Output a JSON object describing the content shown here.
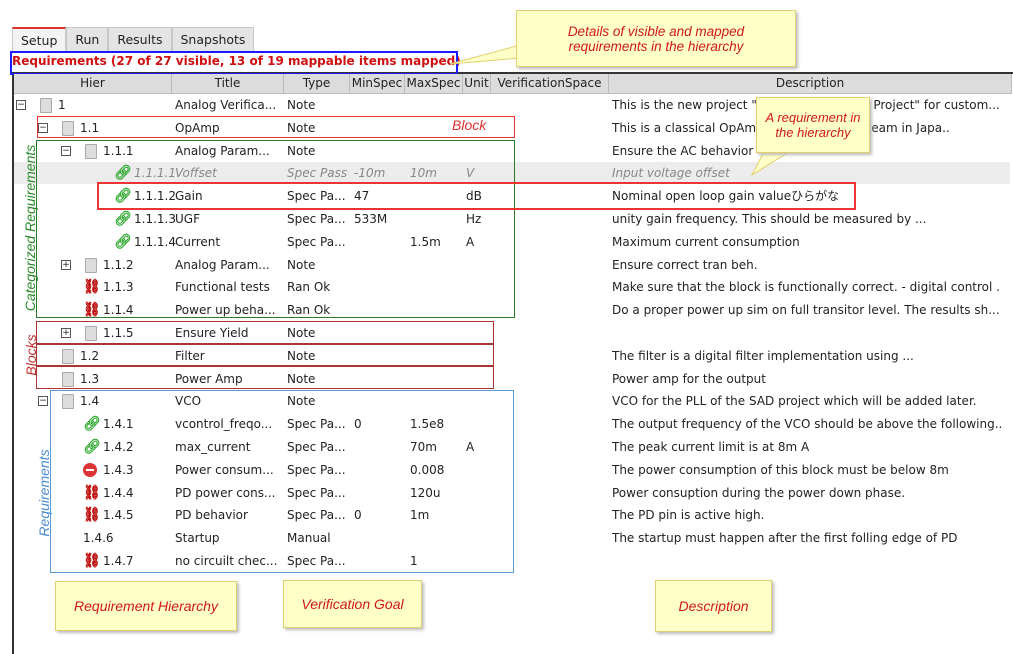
{
  "tabs": [
    "Setup",
    "Run",
    "Results",
    "Snapshots"
  ],
  "requirements_label": "Requirements (27 of 27 visible, 13 of 19 mappable items mapped)",
  "columns": [
    "Hier",
    "Title",
    "Type",
    "MinSpec",
    "MaxSpec",
    "Unit",
    "VerificationSpace",
    "Description"
  ],
  "rows": [
    {
      "hier": "1",
      "level": 0,
      "expander": "minus",
      "icon": "doc",
      "title": "Analog Verifica...",
      "type": "Note",
      "min": "",
      "max": "",
      "unit": "",
      "desc": "This is the new project \"Analog Verification Project\" for custom..."
    },
    {
      "hier": "1.1",
      "level": 1,
      "expander": "minus",
      "icon": "doc",
      "title": "OpAmp",
      "type": "Note",
      "min": "",
      "max": "",
      "unit": "",
      "desc": "This is a classical OpAmp design from our team in Japa.."
    },
    {
      "hier": "1.1.1",
      "level": 2,
      "expander": "minus",
      "icon": "doc",
      "title": "Analog Param...",
      "type": "Note",
      "min": "",
      "max": "",
      "unit": "",
      "desc": "Ensure the AC behavior"
    },
    {
      "hier": "1.1.1.1",
      "level": 3,
      "expander": "",
      "icon": "pass",
      "title": "Voffset",
      "type": "Spec Pass",
      "min": "-10m",
      "max": "10m",
      "unit": "V",
      "desc": "Input voltage offset",
      "grey": true
    },
    {
      "hier": "1.1.1.2",
      "level": 3,
      "expander": "",
      "icon": "pass",
      "title": "Gain",
      "type": "Spec Pa...",
      "min": "47",
      "max": "",
      "unit": "dB",
      "desc": "Nominal open loop gain valueひらがな"
    },
    {
      "hier": "1.1.1.3",
      "level": 3,
      "expander": "",
      "icon": "pass",
      "title": "UGF",
      "type": "Spec Pa...",
      "min": "533M",
      "max": "",
      "unit": "Hz",
      "desc": "unity gain frequency. This should be measured by ..."
    },
    {
      "hier": "1.1.1.4",
      "level": 3,
      "expander": "",
      "icon": "pass",
      "title": "Current",
      "type": "Spec Pa...",
      "min": "",
      "max": "1.5m",
      "unit": "A",
      "desc": "Maximum current consumption"
    },
    {
      "hier": "1.1.2",
      "level": 2,
      "expander": "plus",
      "icon": "doc",
      "title": "Analog Param...",
      "type": "Note",
      "min": "",
      "max": "",
      "unit": "",
      "desc": "Ensure correct tran beh."
    },
    {
      "hier": "1.1.3",
      "level": 2,
      "expander": "",
      "icon": "broken",
      "title": "Functional tests",
      "type": "Ran Ok",
      "min": "",
      "max": "",
      "unit": "",
      "desc": "Make sure that the block is functionally correct. - digital control ."
    },
    {
      "hier": "1.1.4",
      "level": 2,
      "expander": "",
      "icon": "broken",
      "title": "Power up beha...",
      "type": "Ran Ok",
      "min": "",
      "max": "",
      "unit": "",
      "desc": "Do a proper power up sim on full transitor level. The results sh..."
    },
    {
      "hier": "1.1.5",
      "level": 2,
      "expander": "plus",
      "icon": "doc",
      "title": "Ensure Yield",
      "type": "Note",
      "min": "",
      "max": "",
      "unit": "",
      "desc": ""
    },
    {
      "hier": "1.2",
      "level": 1,
      "expander": "",
      "icon": "doc",
      "title": "Filter",
      "type": "Note",
      "min": "",
      "max": "",
      "unit": "",
      "desc": "The filter is a digital filter implementation using ..."
    },
    {
      "hier": "1.3",
      "level": 1,
      "expander": "",
      "icon": "doc",
      "title": "Power Amp",
      "type": "Note",
      "min": "",
      "max": "",
      "unit": "",
      "desc": "Power amp for the output"
    },
    {
      "hier": "1.4",
      "level": 1,
      "expander": "minus",
      "icon": "doc",
      "title": "VCO",
      "type": "Note",
      "min": "",
      "max": "",
      "unit": "",
      "desc": "VCO for the PLL of the SAD project which will be added later."
    },
    {
      "hier": "1.4.1",
      "level": 2,
      "expander": "",
      "icon": "pass",
      "title": "vcontrol_freqo...",
      "type": "Spec Pa...",
      "min": "0",
      "max": "1.5e8",
      "unit": "",
      "desc": "The output frequency of the VCO should be above the following.."
    },
    {
      "hier": "1.4.2",
      "level": 2,
      "expander": "",
      "icon": "pass",
      "title": "max_current",
      "type": "Spec Pa...",
      "min": "",
      "max": "70m",
      "unit": "A",
      "desc": "The peak current limit is at 8m A"
    },
    {
      "hier": "1.4.3",
      "level": 2,
      "expander": "",
      "icon": "fail",
      "title": "Power consum...",
      "type": "Spec Pa...",
      "min": "",
      "max": "0.008",
      "unit": "",
      "desc": "The power consumption of this block must be below 8m"
    },
    {
      "hier": "1.4.4",
      "level": 2,
      "expander": "",
      "icon": "broken",
      "title": "PD power cons...",
      "type": "Spec Pa...",
      "min": "",
      "max": "120u",
      "unit": "",
      "desc": "Power consuption during the power down phase."
    },
    {
      "hier": "1.4.5",
      "level": 2,
      "expander": "",
      "icon": "broken",
      "title": "PD behavior",
      "type": "Spec Pa...",
      "min": "0",
      "max": "1m",
      "unit": "",
      "desc": "The PD pin is active high."
    },
    {
      "hier": "1.4.6",
      "level": 2,
      "expander": "",
      "icon": "none",
      "title": "Startup",
      "type": "Manual",
      "min": "",
      "max": "",
      "unit": "",
      "desc": "The startup must happen after the first folling edge of PD"
    },
    {
      "hier": "1.4.7",
      "level": 2,
      "expander": "",
      "icon": "broken",
      "title": "no circuilt chec...",
      "type": "Spec Pa...",
      "min": "",
      "max": "1",
      "unit": "",
      "desc": ""
    }
  ],
  "annotations": {
    "details": "Details of  visible and  mapped requirements in the hierarchy",
    "requirement": "A requirement in the hierarchy",
    "block": "Block",
    "categorized": "Categorized Requirements",
    "blocks": "Blocks",
    "requirements": "Requirements",
    "hierarchy": "Requirement Hierarchy",
    "goal": "Verification Goal",
    "description": "Description"
  }
}
